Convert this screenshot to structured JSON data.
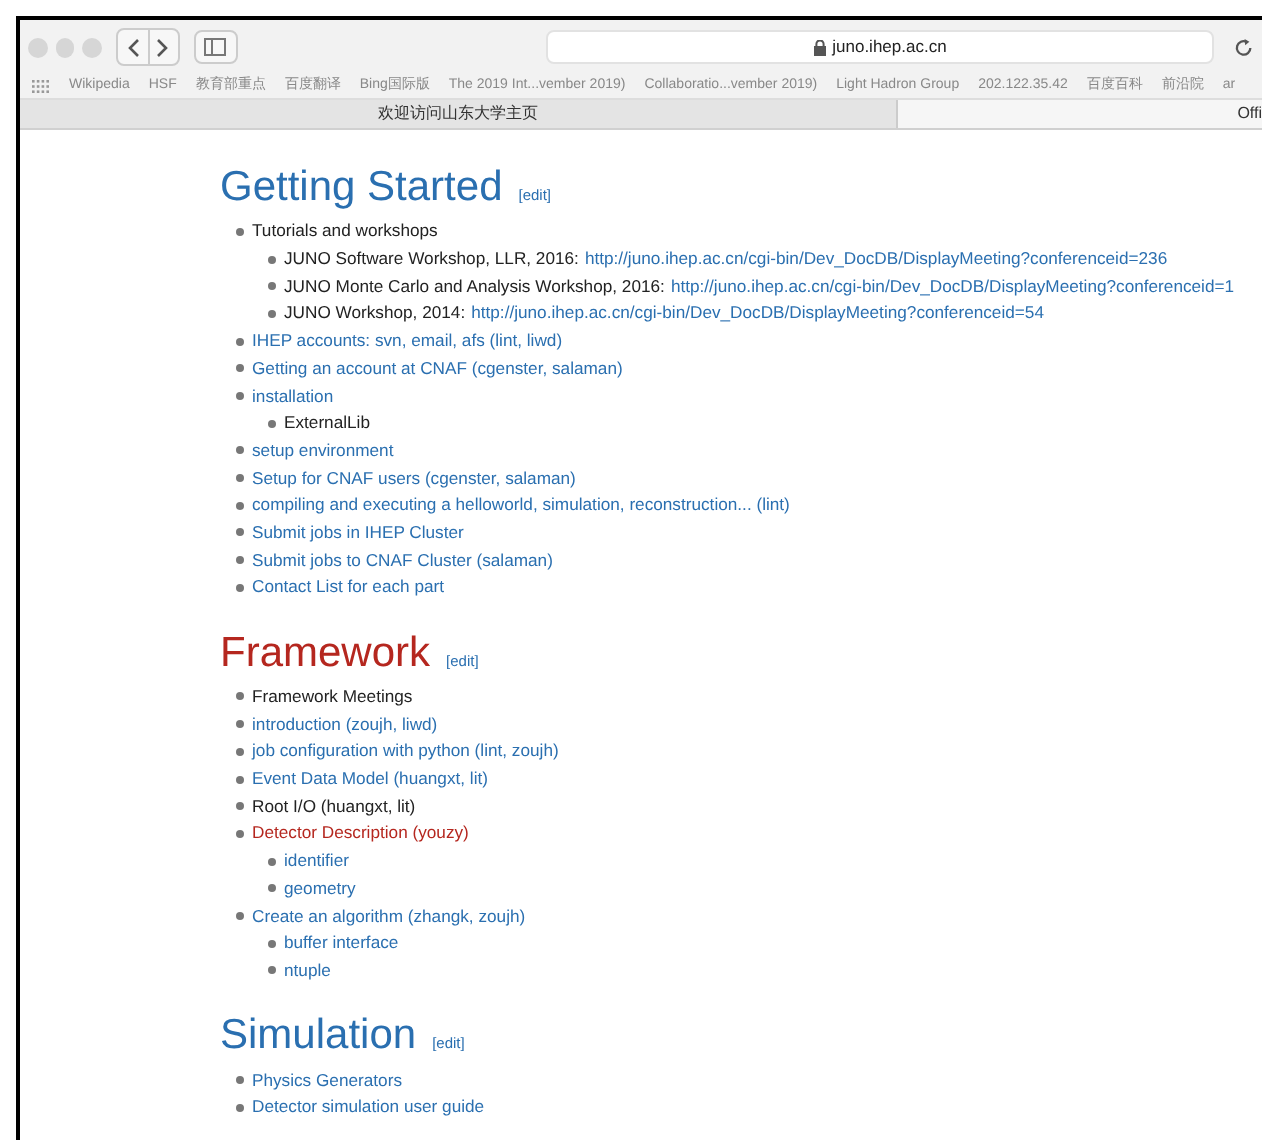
{
  "toolbar": {
    "address": "juno.ihep.ac.cn"
  },
  "bookmarks": [
    "Wikipedia",
    "HSF",
    "教育部重点",
    "百度翻译",
    "Bing国际版",
    "The 2019 Int...vember 2019)",
    "Collaboratio...vember 2019)",
    "Light Hadron Group",
    "202.122.35.42",
    "百度百科",
    "前沿院",
    "ar"
  ],
  "tabs": [
    {
      "label": "欢迎访问山东大学主页",
      "selected": false
    },
    {
      "label": "Offi",
      "selected": true
    }
  ],
  "sections": [
    {
      "heading": "Getting Started",
      "kind": "link",
      "edit": "[edit]",
      "items": [
        {
          "kind": "text",
          "text": "Tutorials and workshops",
          "children": [
            {
              "kind": "text",
              "text": "JUNO Software Workshop, LLR, 2016:",
              "url": "http://juno.ihep.ac.cn/cgi-bin/Dev_DocDB/DisplayMeeting?conferenceid=236"
            },
            {
              "kind": "text",
              "text": "JUNO Monte Carlo and Analysis Workshop, 2016:",
              "url": "http://juno.ihep.ac.cn/cgi-bin/Dev_DocDB/DisplayMeeting?conferenceid=1"
            },
            {
              "kind": "text",
              "text": "JUNO Workshop, 2014:",
              "url": "http://juno.ihep.ac.cn/cgi-bin/Dev_DocDB/DisplayMeeting?conferenceid=54"
            }
          ]
        },
        {
          "kind": "link",
          "text": "IHEP accounts: svn, email, afs (lint, liwd)"
        },
        {
          "kind": "link",
          "text": "Getting an account at CNAF (cgenster, salaman)"
        },
        {
          "kind": "link",
          "text": "installation",
          "children": [
            {
              "kind": "text",
              "text": "ExternalLib"
            }
          ]
        },
        {
          "kind": "link",
          "text": "setup environment"
        },
        {
          "kind": "link",
          "text": "Setup for CNAF users (cgenster, salaman)"
        },
        {
          "kind": "link",
          "text": "compiling and executing a helloworld, simulation, reconstruction... (lint)"
        },
        {
          "kind": "link",
          "text": "Submit jobs in IHEP Cluster"
        },
        {
          "kind": "link",
          "text": "Submit jobs to CNAF Cluster (salaman)"
        },
        {
          "kind": "link",
          "text": "Contact List for each part"
        }
      ]
    },
    {
      "heading": "Framework",
      "kind": "new",
      "edit": "[edit]",
      "items": [
        {
          "kind": "text",
          "text": "Framework Meetings"
        },
        {
          "kind": "link",
          "text": "introduction (zoujh, liwd)"
        },
        {
          "kind": "link",
          "text": "job configuration with python (lint, zoujh)"
        },
        {
          "kind": "link",
          "text": "Event Data Model (huangxt, lit)"
        },
        {
          "kind": "text",
          "text": "Root I/O (huangxt, lit)"
        },
        {
          "kind": "new",
          "text": "Detector Description (youzy)",
          "children": [
            {
              "kind": "link",
              "text": "identifier"
            },
            {
              "kind": "link",
              "text": "geometry"
            }
          ]
        },
        {
          "kind": "link",
          "text": "Create an algorithm (zhangk, zoujh)",
          "children": [
            {
              "kind": "link",
              "text": "buffer interface"
            },
            {
              "kind": "link",
              "text": "ntuple"
            }
          ]
        }
      ]
    },
    {
      "heading": "Simulation",
      "kind": "link",
      "edit": "[edit]",
      "items": [
        {
          "kind": "link",
          "text": "Physics Generators"
        },
        {
          "kind": "link",
          "text": "Detector simulation user guide"
        }
      ]
    }
  ]
}
